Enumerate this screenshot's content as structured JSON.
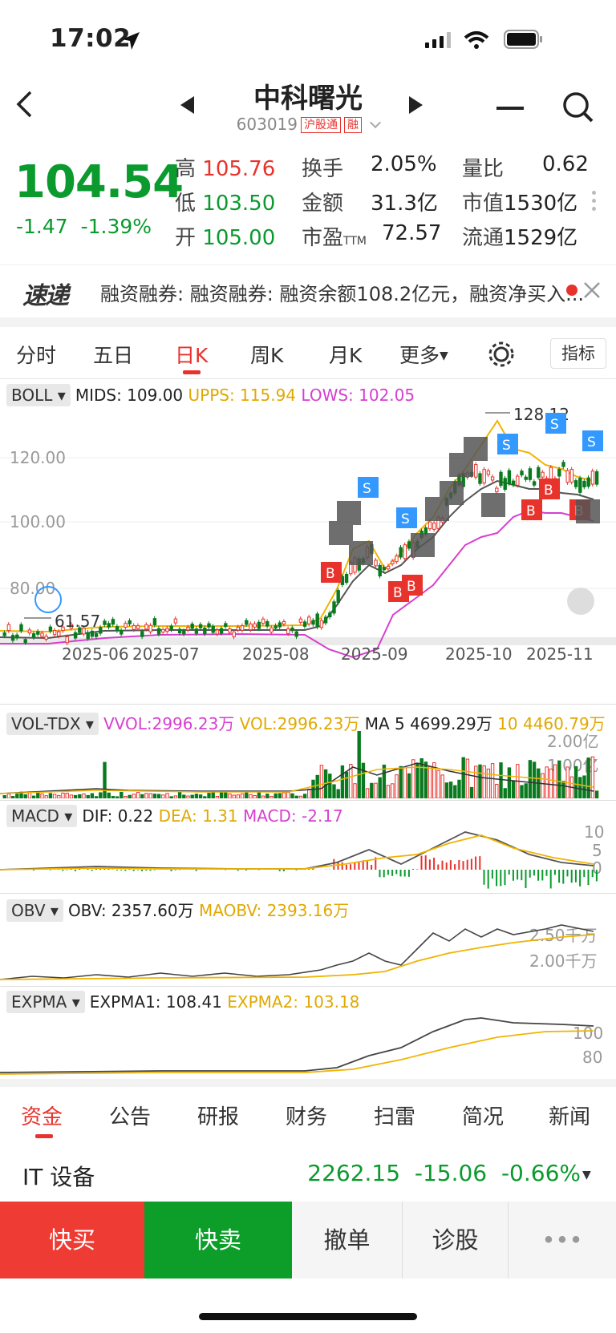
{
  "status": {
    "time": "17:02"
  },
  "header": {
    "title": "中科曙光",
    "code": "603019",
    "tag1": "沪股通",
    "tag2": "融"
  },
  "quote": {
    "price": "104.54",
    "change": "-1.47",
    "change_pct": "-1.39%",
    "high_label": "高",
    "high": "105.76",
    "low_label": "低",
    "low": "103.50",
    "open_label": "开",
    "open": "105.00",
    "turnover_label": "换手",
    "turnover": "2.05%",
    "amount_label": "金额",
    "amount": "31.3亿",
    "pe_label": "市盈",
    "pe_sub": "TTM",
    "pe": "72.57",
    "vol_ratio_label": "量比",
    "vol_ratio": "0.62",
    "mcap_label": "市值",
    "mcap": "1530亿",
    "float_label": "流通",
    "float_cap": "1529亿"
  },
  "news": {
    "logo": "速递",
    "text": "融资融券: 融资融券: 融资余额108.2亿元，融资净买入..."
  },
  "period_tabs": [
    "分时",
    "五日",
    "日K",
    "周K",
    "月K",
    "更多"
  ],
  "indicator_button": "指标",
  "boll": {
    "name": "BOLL",
    "mids": "MIDS: 109.00",
    "upps": "UPPS: 115.94",
    "lows": "LOWS: 102.05",
    "y_labels": [
      "120.00",
      "100.00",
      "80.00"
    ],
    "high_mark": "128.12",
    "low_mark": "61.57",
    "dates": [
      "2025-06",
      "2025-07",
      "2025-08",
      "2025-09",
      "2025-10",
      "2025-11"
    ]
  },
  "vol": {
    "name": "VOL-TDX",
    "vvol": "VVOL:2996.23万",
    "vol": "VOL:2996.23万",
    "ma5": "MA 5 4699.29万",
    "ma10": "10 4460.79万",
    "y_labels": [
      "2.00亿",
      "1.00亿"
    ]
  },
  "macd": {
    "name": "MACD",
    "dif": "DIF: 0.22",
    "dea": "DEA: 1.31",
    "macd": "MACD: -2.17",
    "y_labels": [
      "10",
      "5",
      "0"
    ]
  },
  "obv": {
    "name": "OBV",
    "obv": "OBV: 2357.60万",
    "maobv": "MAOBV: 2393.16万",
    "y_labels": [
      "2.50千万",
      "2.00千万"
    ]
  },
  "expma": {
    "name": "EXPMA",
    "e1": "EXPMA1: 108.41",
    "e2": "EXPMA2: 103.18",
    "y_labels": [
      "100",
      "80"
    ]
  },
  "bottom_tabs": [
    "资金",
    "公告",
    "研报",
    "财务",
    "扫雷",
    "简况",
    "新闻"
  ],
  "industry": {
    "name": "IT 设备",
    "value": "2262.15",
    "change": "-15.06",
    "pct": "-0.66%"
  },
  "trade_bar": {
    "buy": "快买",
    "sell": "快卖",
    "cancel": "撤单",
    "diagnose": "诊股"
  }
}
